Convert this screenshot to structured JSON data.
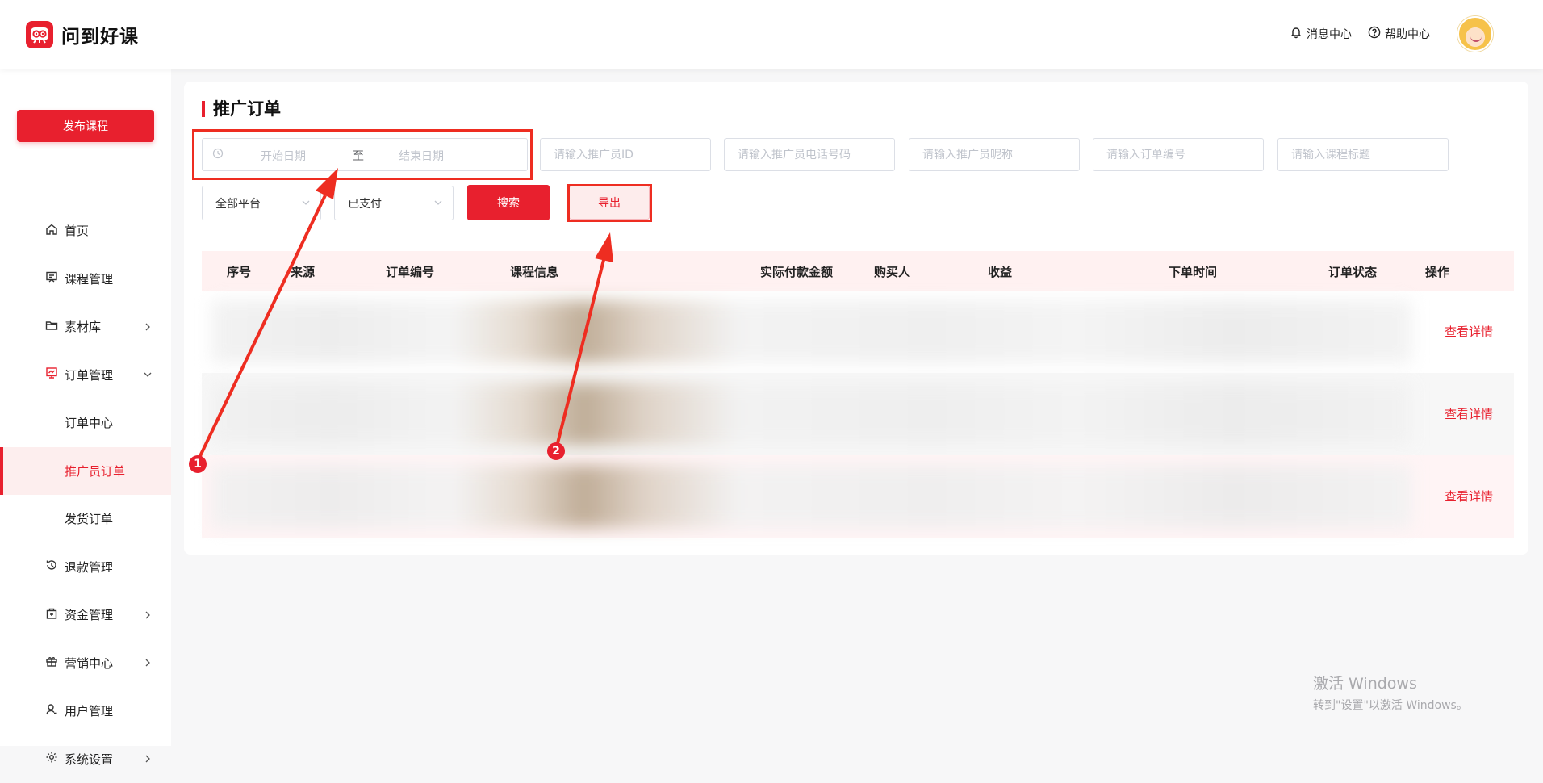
{
  "app": {
    "name": "问到好课",
    "brand_color": "#e8202e"
  },
  "header": {
    "messages": "消息中心",
    "help": "帮助中心"
  },
  "sidebar": {
    "publish_label": "发布课程",
    "items": [
      {
        "label": "首页",
        "icon": "home-icon"
      },
      {
        "label": "课程管理",
        "icon": "course-icon"
      },
      {
        "label": "素材库",
        "icon": "folder-icon",
        "has_arrow": true
      },
      {
        "label": "订单管理",
        "icon": "order-icon",
        "expanded": true
      },
      {
        "label": "订单中心",
        "sub": true
      },
      {
        "label": "推广员订单",
        "sub": true,
        "active": true
      },
      {
        "label": "发货订单",
        "sub": true
      },
      {
        "label": "退款管理",
        "icon": "refund-icon"
      },
      {
        "label": "资金管理",
        "icon": "wallet-icon",
        "has_arrow": true
      },
      {
        "label": "营销中心",
        "icon": "gift-icon",
        "has_arrow": true
      },
      {
        "label": "用户管理",
        "icon": "user-icon"
      },
      {
        "label": "系统设置",
        "icon": "gear-icon",
        "has_arrow": true
      }
    ]
  },
  "main": {
    "title": "推广订单",
    "filters": {
      "date_start": "开始日期",
      "date_separator": "至",
      "date_end": "结束日期",
      "promoter_id": "请输入推广员ID",
      "promoter_phone": "请输入推广员电话号码",
      "promoter_nick": "请输入推广员昵称",
      "order_no": "请输入订单编号",
      "course_title": "请输入课程标题",
      "platform": "全部平台",
      "pay_status": "已支付"
    },
    "search_label": "搜索",
    "export_label": "导出",
    "table": {
      "columns": [
        "序号",
        "来源",
        "订单编号",
        "课程信息",
        "实际付款金额",
        "购买人",
        "收益",
        "下单时间",
        "订单状态",
        "操作"
      ],
      "rows": [
        {
          "action": "查看详情"
        },
        {
          "action": "查看详情"
        },
        {
          "action": "查看详情"
        }
      ]
    }
  },
  "annotations": {
    "badge_1": "1",
    "badge_2": "2",
    "color": "#ee2d21"
  },
  "watermark": {
    "line1": "激活 Windows",
    "line2": "转到\"设置\"以激活 Windows。"
  }
}
